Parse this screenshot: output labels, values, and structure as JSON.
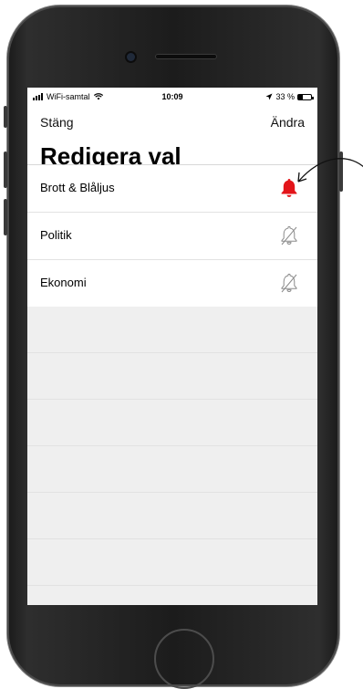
{
  "status_bar": {
    "carrier": "WiFi-samtal",
    "time": "10:09",
    "battery_text": "33 %",
    "battery_level": 0.33
  },
  "nav": {
    "close_label": "Stäng",
    "edit_label": "Ändra",
    "title": "Redigera val"
  },
  "items": [
    {
      "label": "Brott & Blåljus",
      "icon": "bell-icon",
      "notifications_on": true
    },
    {
      "label": "Politik",
      "icon": "bell-off-icon",
      "notifications_on": false
    },
    {
      "label": "Ekonomi",
      "icon": "bell-off-icon",
      "notifications_on": false
    }
  ],
  "colors": {
    "bell_active": "#e3151a",
    "bell_inactive": "#8a8a8a"
  }
}
